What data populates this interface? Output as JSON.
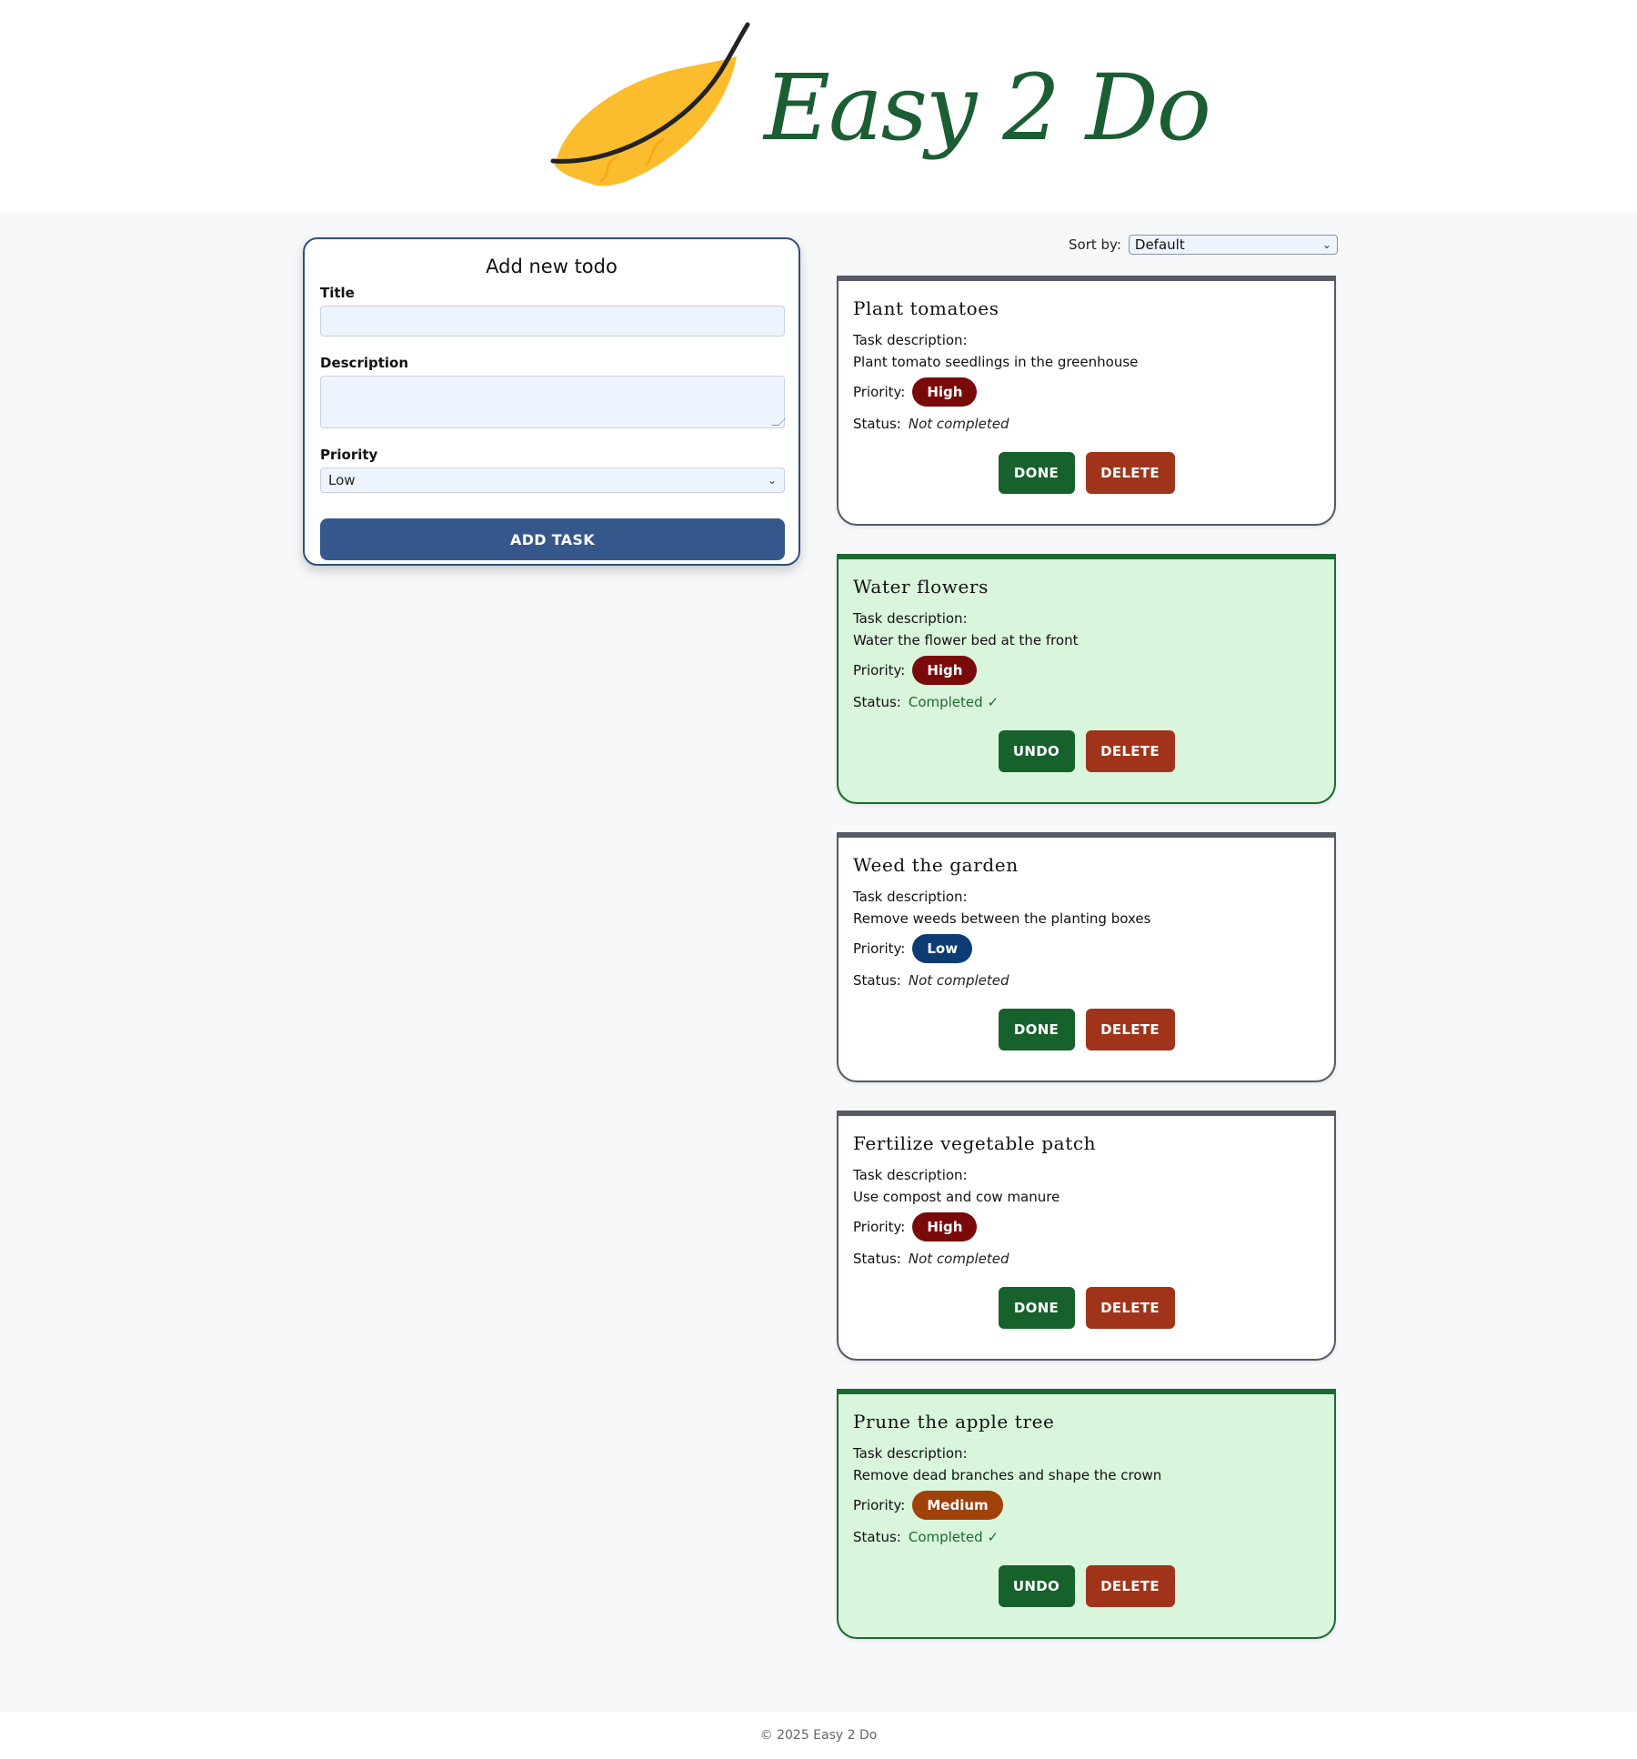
{
  "header": {
    "brand": "Easy 2 Do",
    "logo_icon": "feather-icon",
    "colors": {
      "brand_text": "#1b5e33",
      "feather": "#fbbd2e"
    }
  },
  "form": {
    "title": "Add new todo",
    "title_label": "Title",
    "title_value": "",
    "description_label": "Description",
    "description_value": "",
    "priority_label": "Priority",
    "priority_selected": "Low",
    "submit_label": "ADD TASK"
  },
  "sort": {
    "label": "Sort by:",
    "selected": "Default"
  },
  "labels": {
    "task_description": "Task description:",
    "priority": "Priority:",
    "status": "Status:"
  },
  "tasks": [
    {
      "title": "Plant tomatoes",
      "description": "Plant tomato seedlings in the greenhouse",
      "priority": "High",
      "priority_color": "#7a0a0a",
      "status": "Not completed",
      "completed": false,
      "primary_action": "DONE",
      "delete_action": "DELETE"
    },
    {
      "title": "Water flowers",
      "description": "Water the flower bed at the front",
      "priority": "High",
      "priority_color": "#7a0a0a",
      "status": "Completed ✓",
      "completed": true,
      "primary_action": "UNDO",
      "delete_action": "DELETE"
    },
    {
      "title": "Weed the garden",
      "description": "Remove weeds between the planting boxes",
      "priority": "Low",
      "priority_color": "#0d3b73",
      "status": "Not completed",
      "completed": false,
      "primary_action": "DONE",
      "delete_action": "DELETE"
    },
    {
      "title": "Fertilize vegetable patch",
      "description": "Use compost and cow manure",
      "priority": "High",
      "priority_color": "#7a0a0a",
      "status": "Not completed",
      "completed": false,
      "primary_action": "DONE",
      "delete_action": "DELETE"
    },
    {
      "title": "Prune the apple tree",
      "description": "Remove dead branches and shape the crown",
      "priority": "Medium",
      "priority_color": "#a0410a",
      "status": "Completed ✓",
      "completed": true,
      "primary_action": "UNDO",
      "delete_action": "DELETE"
    }
  ],
  "footer": {
    "text": "© 2025 Easy 2 Do"
  }
}
